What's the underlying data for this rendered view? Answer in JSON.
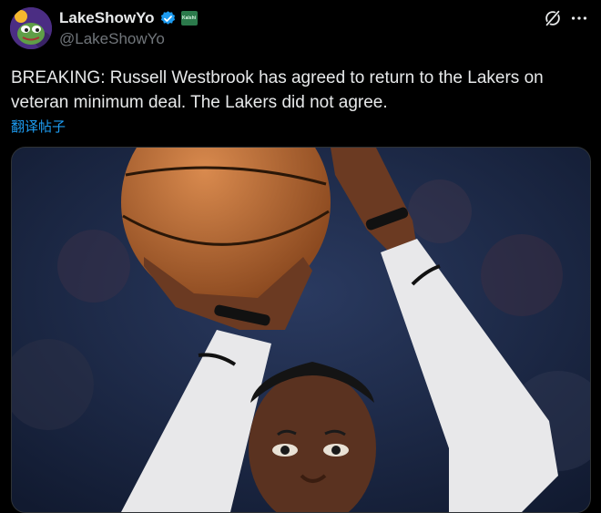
{
  "author": {
    "display_name": "LakeShowYo",
    "handle": "@LakeShowYo",
    "affiliate_badge_text": "Kalshi"
  },
  "tweet": {
    "text": "BREAKING: Russell Westbrook has agreed to return to the Lakers on\nveteran minimum deal. The Lakers did not agree.",
    "translate_label": "翻译帖子"
  },
  "icons": {
    "verified": "verified-badge-icon",
    "grok": "grok-icon",
    "more": "more-options-icon"
  },
  "colors": {
    "background": "#000000",
    "text": "#e7e9ea",
    "secondary_text": "#71767b",
    "link": "#1d9bf0",
    "verified": "#1d9bf0"
  }
}
